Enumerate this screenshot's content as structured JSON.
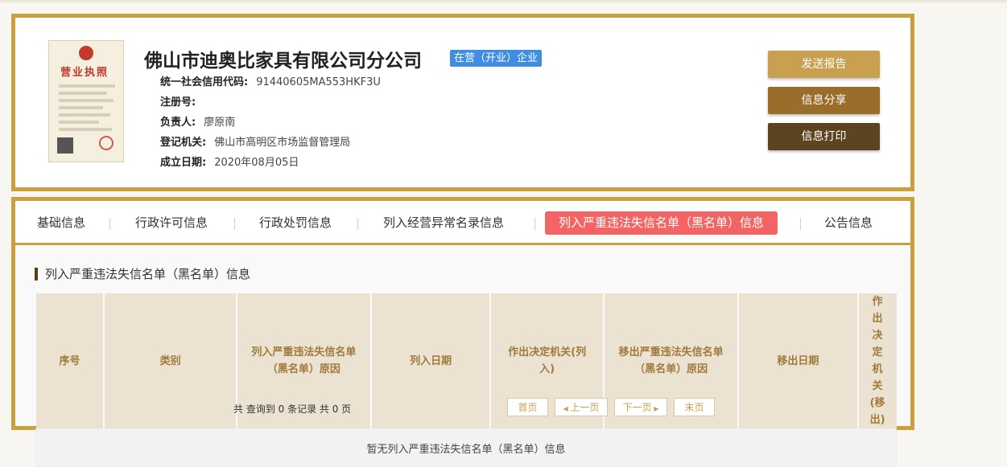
{
  "company": {
    "name": "佛山市迪奥比家具有限公司分公司",
    "status": "在营（开业）企业",
    "license_title": "营业执照",
    "fields": [
      {
        "label": "统一社会信用代码:",
        "value": "91440605MA553HKF3U"
      },
      {
        "label": "注册号:",
        "value": ""
      },
      {
        "label": "负责人:",
        "value": "廖原南"
      },
      {
        "label": "登记机关:",
        "value": "佛山市高明区市场监督管理局"
      },
      {
        "label": "成立日期:",
        "value": "2020年08月05日"
      }
    ]
  },
  "actions": {
    "report": "发送报告",
    "share": "信息分享",
    "print": "信息打印"
  },
  "tabs": [
    {
      "label": "基础信息"
    },
    {
      "label": "行政许可信息"
    },
    {
      "label": "行政处罚信息"
    },
    {
      "label": "列入经营异常名录信息"
    },
    {
      "label": "列入严重违法失信名单（黑名单）信息"
    },
    {
      "label": "公告信息"
    }
  ],
  "section": {
    "title": "列入严重违法失信名单（黑名单）信息",
    "columns": [
      "序号",
      "类别",
      "列入严重违法失信名单（黑名单）原因",
      "列入日期",
      "作出决定机关(列入)",
      "移出严重违法失信名单（黑名单）原因",
      "移出日期",
      "作出决定机关(移出)"
    ],
    "empty_message": "暂无列入严重违法失信名单（黑名单）信息"
  },
  "pagination": {
    "summary": "共 查询到 0 条记录 共 0 页",
    "first": "首页",
    "prev": "上一页",
    "next": "下一页",
    "last": "末页"
  },
  "colors": {
    "frame": "#c9a040",
    "active_tab": "#f36565",
    "status_badge": "#3f8ee0"
  }
}
